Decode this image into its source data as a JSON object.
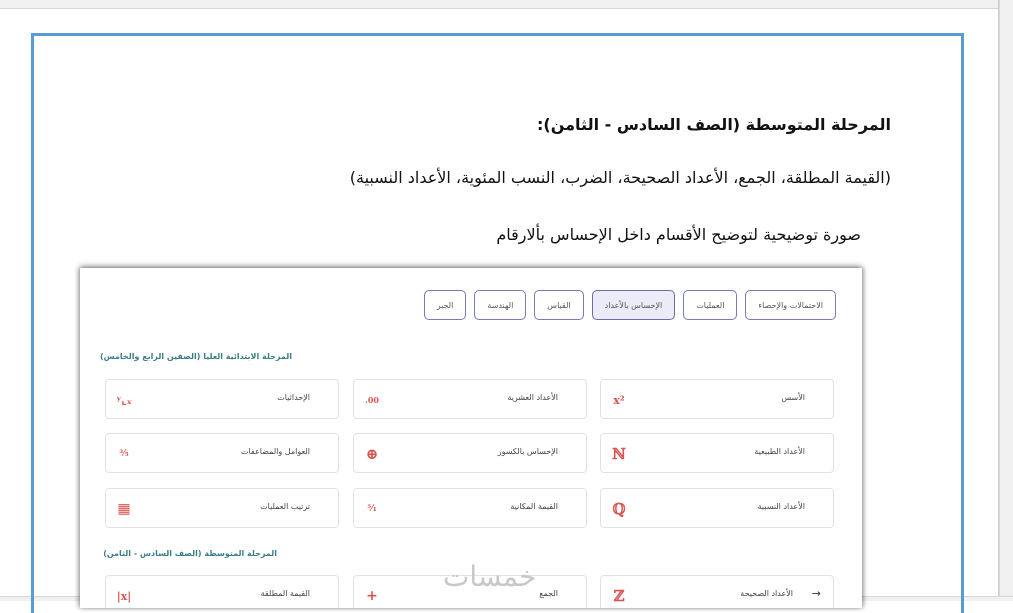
{
  "document": {
    "heading": "المرحلة المتوسطة (الصف السادس - الثامن):",
    "topics": "(القيمة المطلقة، الجمع، الأعداد الصحيحة، الضرب، النسب المئوية، الأعداد النسبية)",
    "caption": "صورة توضيحية لتوضيح  الأقسام داخل  الإحساس بألارقام"
  },
  "screenshot": {
    "tabs": [
      "الاحتمالات والإحصاء",
      "العمليات",
      "الإحساس بالأعداد",
      "القياس",
      "الهندسة",
      "الجبر"
    ],
    "active_tab": 2,
    "section_upper": "المرحلة الابتدائية العليا (الصفين الرابع والخامس)",
    "section_middle": "المرحلة المتوسطة (الصف السادس - الثامن)",
    "cards_upper": [
      {
        "label": "الأسس",
        "icon": "x²"
      },
      {
        "label": "الأعداد العشرية",
        "icon": ".00"
      },
      {
        "label": "الإحداثيات",
        "icon": "ʸ⌞ₓ"
      },
      {
        "label": "الأعداد الطبيعية",
        "icon": "ℕ"
      },
      {
        "label": "الإحساس بالكسور",
        "icon": "⊕"
      },
      {
        "label": "العوامل والمضاعفات",
        "icon": "³⁄₅"
      },
      {
        "label": "الأعداد النسبية",
        "icon": "ℚ"
      },
      {
        "label": "القيمة المكانية",
        "icon": "⁵⁄₁"
      },
      {
        "label": "ترتيب العمليات",
        "icon": "▦"
      }
    ],
    "cards_middle": [
      {
        "label": "الأعداد الصحيحة",
        "icon": "ℤ"
      },
      {
        "label": "الجمع",
        "icon": "+"
      },
      {
        "label": "القيمة المطلقة",
        "icon": "|x|"
      }
    ],
    "arrow": "→"
  },
  "watermark": "خمسات",
  "colors": {
    "frame": "#5b9bd5",
    "accent": "#3a7f86",
    "icon": "#d9534f",
    "tab_border": "#7a7ab8"
  }
}
